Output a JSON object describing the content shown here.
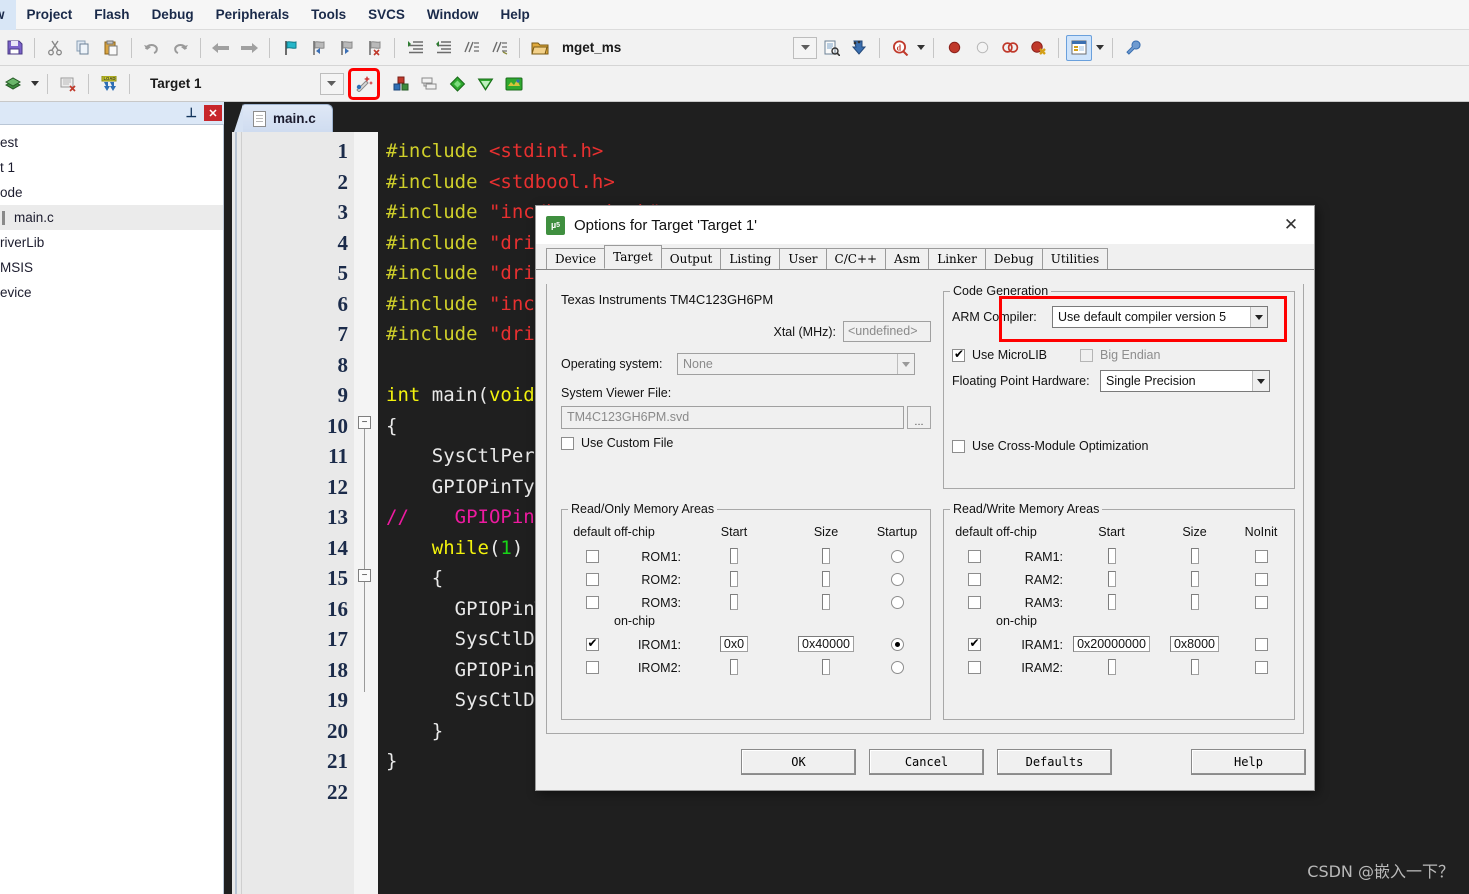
{
  "menubar": {
    "items": [
      {
        "label": "w",
        "name": "menu-view"
      },
      {
        "label": "Project",
        "name": "menu-project"
      },
      {
        "label": "Flash",
        "name": "menu-flash"
      },
      {
        "label": "Debug",
        "name": "menu-debug"
      },
      {
        "label": "Peripherals",
        "name": "menu-peripherals"
      },
      {
        "label": "Tools",
        "name": "menu-tools"
      },
      {
        "label": "SVCS",
        "name": "menu-svcs"
      },
      {
        "label": "Window",
        "name": "menu-window"
      },
      {
        "label": "Help",
        "name": "menu-help"
      }
    ]
  },
  "toolbar1": {
    "find_value": "mget_ms",
    "icons": [
      "save-all-icon",
      "cut-icon",
      "copy-icon",
      "paste-icon",
      "undo-icon",
      "redo-icon",
      "navigate-back-icon",
      "navigate-forward-icon",
      "bookmark-icon",
      "bookmark-prev-icon",
      "bookmark-next-icon",
      "bookmark-clear-icon",
      "indent-icon",
      "outdent-icon",
      "comment-icon",
      "uncomment-icon",
      "open-file-icon",
      "dropdown-icon",
      "find-in-files-icon",
      "insert-icon",
      "find-icon",
      "breakpoint-icon",
      "breakpoint-disable-icon",
      "breakpoint-remove-icon",
      "breakpoint-kill-icon",
      "window-layout-icon",
      "configure-icon"
    ]
  },
  "toolbar2": {
    "target_label": "Target 1",
    "magic_wand_tooltip": "Options for Target",
    "icons": [
      "build-icon",
      "build-dropdown-icon",
      "batch-build-icon",
      "download-icon",
      "dropdown-icon",
      "magic-wand-icon",
      "manage-components-icon",
      "multi-project-icon",
      "pack-installer-icon",
      "pack-green-icon",
      "pack-world-icon"
    ],
    "highlight_color": "#ff0000"
  },
  "leftpanel": {
    "pin_icon": "pin-icon",
    "close_icon": "close-icon",
    "tree": [
      {
        "label": "est",
        "name": "tree-item-project",
        "selected": false,
        "bar": false
      },
      {
        "label": "t 1",
        "name": "tree-item-target",
        "selected": false,
        "bar": false
      },
      {
        "label": "ode",
        "name": "tree-item-source-code",
        "selected": false,
        "bar": false
      },
      {
        "label": "main.c",
        "name": "tree-item-mainc",
        "selected": true,
        "bar": true
      },
      {
        "label": "riverLib",
        "name": "tree-item-driverlib",
        "selected": false,
        "bar": false
      },
      {
        "label": "MSIS",
        "name": "tree-item-cmsis",
        "selected": false,
        "bar": false
      },
      {
        "label": "evice",
        "name": "tree-item-device",
        "selected": false,
        "bar": false
      }
    ]
  },
  "editor": {
    "tab_label": "main.c",
    "line_numbers": [
      1,
      2,
      3,
      4,
      5,
      6,
      7,
      8,
      9,
      10,
      11,
      12,
      13,
      14,
      15,
      16,
      17,
      18,
      19,
      20,
      21,
      22
    ],
    "lines": [
      {
        "n": 1,
        "tokens": [
          {
            "t": "#include ",
            "c": "k-inc"
          },
          {
            "t": "<stdint.h>",
            "c": "k-str"
          }
        ]
      },
      {
        "n": 2,
        "tokens": [
          {
            "t": "#include ",
            "c": "k-inc"
          },
          {
            "t": "<stdbool.h>",
            "c": "k-str"
          }
        ]
      },
      {
        "n": 3,
        "tokens": [
          {
            "t": "#include ",
            "c": "k-inc"
          },
          {
            "t": "\"inc/hw_gpio.h\"",
            "c": "k-str"
          }
        ]
      },
      {
        "n": 4,
        "tokens": [
          {
            "t": "#include ",
            "c": "k-inc"
          },
          {
            "t": "\"dri",
            "c": "k-str"
          }
        ]
      },
      {
        "n": 5,
        "tokens": [
          {
            "t": "#include ",
            "c": "k-inc"
          },
          {
            "t": "\"dri",
            "c": "k-str"
          }
        ]
      },
      {
        "n": 6,
        "tokens": [
          {
            "t": "#include ",
            "c": "k-inc"
          },
          {
            "t": "\"inc",
            "c": "k-str"
          }
        ]
      },
      {
        "n": 7,
        "tokens": [
          {
            "t": "#include ",
            "c": "k-inc"
          },
          {
            "t": "\"dri",
            "c": "k-str"
          }
        ]
      },
      {
        "n": 8,
        "tokens": []
      },
      {
        "n": 9,
        "tokens": [
          {
            "t": "int ",
            "c": "k-kw"
          },
          {
            "t": "main(",
            "c": "k-pln"
          },
          {
            "t": "void",
            "c": "k-kw"
          },
          {
            "t": ")",
            "c": "k-pln"
          }
        ]
      },
      {
        "n": 10,
        "tokens": [
          {
            "t": "{",
            "c": "k-pln"
          }
        ]
      },
      {
        "n": 11,
        "tokens": [
          {
            "t": "    SysCtlPer",
            "c": "k-pln"
          }
        ]
      },
      {
        "n": 12,
        "tokens": [
          {
            "t": "    GPIOPinTyp",
            "c": "k-pln"
          }
        ]
      },
      {
        "n": 13,
        "tokens": [
          {
            "t": "//    GPIOPin",
            "c": "k-cmt"
          }
        ]
      },
      {
        "n": 14,
        "tokens": [
          {
            "t": "    while",
            "c": "k-kw"
          },
          {
            "t": "(",
            "c": "k-pln"
          },
          {
            "t": "1",
            "c": "k-num"
          },
          {
            "t": ")",
            "c": "k-pln"
          }
        ]
      },
      {
        "n": 15,
        "tokens": [
          {
            "t": "    {",
            "c": "k-pln"
          }
        ]
      },
      {
        "n": 16,
        "tokens": [
          {
            "t": "      GPIOPinW",
            "c": "k-pln"
          }
        ]
      },
      {
        "n": 17,
        "tokens": [
          {
            "t": "      SysCtlDe",
            "c": "k-pln"
          }
        ]
      },
      {
        "n": 18,
        "tokens": [
          {
            "t": "      GPIOPinW",
            "c": "k-pln"
          }
        ]
      },
      {
        "n": 19,
        "tokens": [
          {
            "t": "      SysCtlDe",
            "c": "k-pln"
          }
        ]
      },
      {
        "n": 20,
        "tokens": [
          {
            "t": "    }",
            "c": "k-pln"
          }
        ]
      },
      {
        "n": 21,
        "tokens": [
          {
            "t": "}",
            "c": "k-pln"
          }
        ]
      },
      {
        "n": 22,
        "tokens": []
      }
    ]
  },
  "dialog": {
    "title": "Options for Target 'Target 1'",
    "icon": "uvision-icon",
    "close_icon": "close-icon",
    "tabs": [
      {
        "label": "Device",
        "selected": false
      },
      {
        "label": "Target",
        "selected": true
      },
      {
        "label": "Output",
        "selected": false
      },
      {
        "label": "Listing",
        "selected": false
      },
      {
        "label": "User",
        "selected": false
      },
      {
        "label": "C/C++",
        "selected": false
      },
      {
        "label": "Asm",
        "selected": false
      },
      {
        "label": "Linker",
        "selected": false
      },
      {
        "label": "Debug",
        "selected": false
      },
      {
        "label": "Utilities",
        "selected": false
      }
    ],
    "device_name": "Texas Instruments TM4C123GH6PM",
    "xtal_label": "Xtal (MHz):",
    "xtal_value": "<undefined>",
    "os_label": "Operating system:",
    "os_value": "None",
    "svd_label": "System Viewer File:",
    "svd_value": "TM4C123GH6PM.svd",
    "svd_browse_label": "...",
    "use_custom_file_label": "Use Custom File",
    "use_custom_file_checked": false,
    "codegen": {
      "legend": "Code Generation",
      "compiler_label": "ARM Compiler:",
      "compiler_value": "Use default compiler version 5",
      "microlib_label": "Use MicroLIB",
      "microlib_checked": true,
      "bigendian_label": "Big Endian",
      "bigendian_checked": false,
      "bigendian_disabled": true,
      "fpu_label": "Floating Point Hardware:",
      "fpu_value": "Single Precision",
      "cmo_label": "Use Cross-Module Optimization",
      "cmo_checked": false,
      "highlight_color": "#ff0000"
    },
    "rom": {
      "legend": "Read/Only Memory Areas",
      "headers": [
        "default",
        "off-chip",
        "Start",
        "Size",
        "Startup"
      ],
      "onchip_label": "on-chip",
      "rows": [
        {
          "name": "ROM1:",
          "checked": false,
          "start": "",
          "size": "",
          "startup": false
        },
        {
          "name": "ROM2:",
          "checked": false,
          "start": "",
          "size": "",
          "startup": false
        },
        {
          "name": "ROM3:",
          "checked": false,
          "start": "",
          "size": "",
          "startup": false
        },
        {
          "name": "IROM1:",
          "checked": true,
          "start": "0x0",
          "size": "0x40000",
          "startup": true
        },
        {
          "name": "IROM2:",
          "checked": false,
          "start": "",
          "size": "",
          "startup": false
        }
      ]
    },
    "ram": {
      "legend": "Read/Write Memory Areas",
      "headers": [
        "default",
        "off-chip",
        "Start",
        "Size",
        "NoInit"
      ],
      "onchip_label": "on-chip",
      "rows": [
        {
          "name": "RAM1:",
          "checked": false,
          "start": "",
          "size": "",
          "noinit": false
        },
        {
          "name": "RAM2:",
          "checked": false,
          "start": "",
          "size": "",
          "noinit": false
        },
        {
          "name": "RAM3:",
          "checked": false,
          "start": "",
          "size": "",
          "noinit": false
        },
        {
          "name": "IRAM1:",
          "checked": true,
          "start": "0x20000000",
          "size": "0x8000",
          "noinit": false
        },
        {
          "name": "IRAM2:",
          "checked": false,
          "start": "",
          "size": "",
          "noinit": false
        }
      ]
    },
    "buttons": {
      "ok": "OK",
      "cancel": "Cancel",
      "defaults": "Defaults",
      "help": "Help"
    }
  },
  "watermark": "CSDN @嵌入一下？"
}
